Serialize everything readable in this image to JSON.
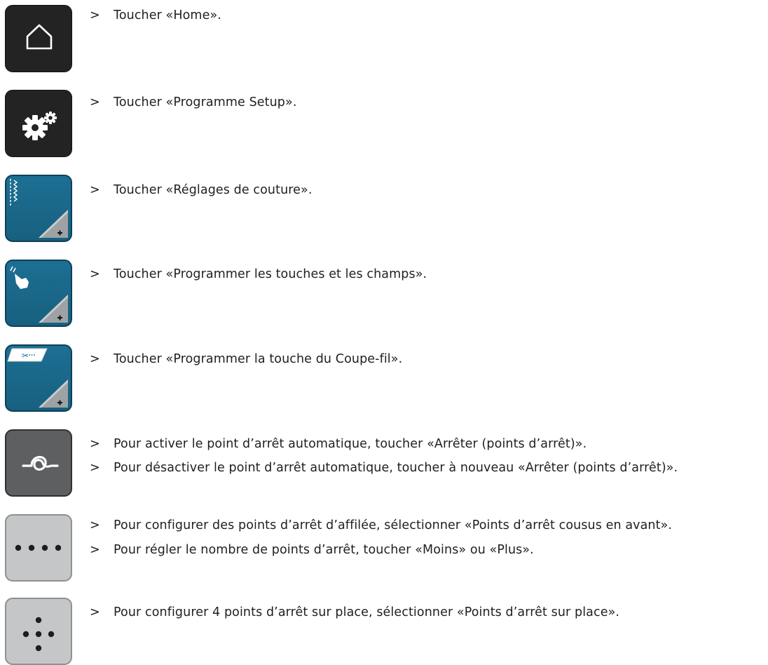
{
  "bullet": ">",
  "steps": [
    {
      "icon": "home-icon",
      "texts": [
        "Toucher «Home»."
      ]
    },
    {
      "icon": "gears-icon",
      "texts": [
        "Toucher «Programme Setup»."
      ]
    },
    {
      "icon": "stitch-settings-icon",
      "texts": [
        "Toucher «Réglages de couture»."
      ]
    },
    {
      "icon": "hand-pointer-icon",
      "texts": [
        "Toucher «Programmer les touches et les champs»."
      ]
    },
    {
      "icon": "thread-cutter-icon",
      "texts": [
        "Toucher «Programmer la touche du Coupe-fil»."
      ]
    },
    {
      "icon": "securing-stitch-icon",
      "texts": [
        "Pour activer le point d’arrêt automatique, toucher «Arrêter (points d’arrêt)».",
        "Pour désactiver le point d’arrêt automatique, toucher à nouveau «Arrêter (points d’arrêt)»."
      ]
    },
    {
      "icon": "forward-stitches-icon",
      "texts": [
        "Pour configurer des points d’arrêt d’affilée, sélectionner «Points d’arrêt cousus en avant».",
        "Pour régler le nombre de points d’arrêt, toucher «Moins» ou «Plus»."
      ]
    },
    {
      "icon": "in-place-stitches-icon",
      "texts": [
        "Pour configurer 4 points d’arrêt sur place, sélectionner «Points d’arrêt sur place»."
      ]
    }
  ]
}
